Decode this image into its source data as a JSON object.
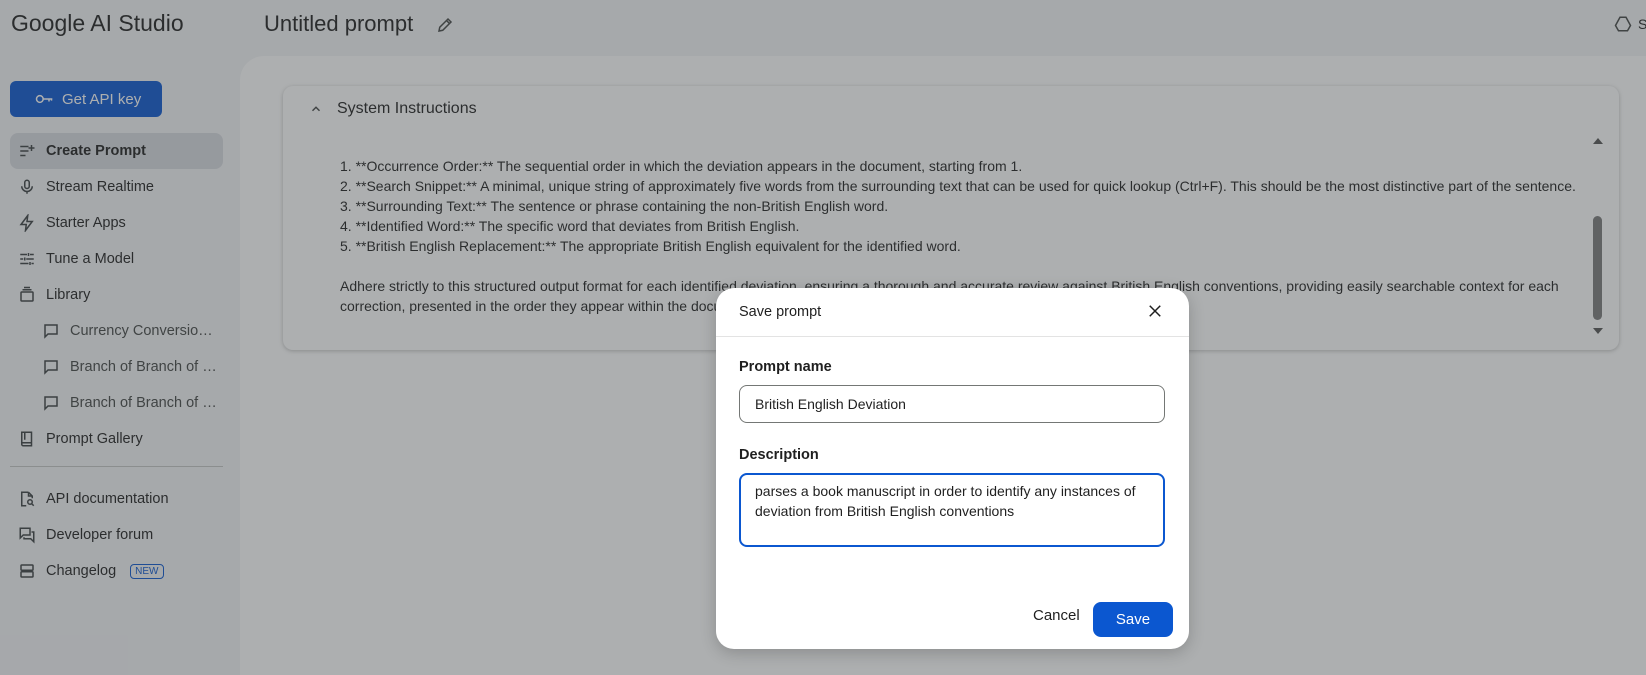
{
  "app": {
    "brand": "Google AI Studio",
    "prompt_title": "Untitled prompt",
    "top_right_partial": "S"
  },
  "sidebar": {
    "api_key_label": "Get API key",
    "items": [
      {
        "label": "Create Prompt",
        "icon": "create-prompt-icon",
        "active": true
      },
      {
        "label": "Stream Realtime",
        "icon": "mic-icon"
      },
      {
        "label": "Starter Apps",
        "icon": "bolt-icon"
      },
      {
        "label": "Tune a Model",
        "icon": "tune-icon"
      },
      {
        "label": "Library",
        "icon": "library-icon"
      }
    ],
    "library_items": [
      {
        "label": "Currency Conversion ..."
      },
      {
        "label": "Branch of Branch of B..."
      },
      {
        "label": "Branch of Branch of B..."
      }
    ],
    "gallery_label": "Prompt Gallery",
    "bottom_items": [
      {
        "label": "API documentation",
        "icon": "doc-search-icon"
      },
      {
        "label": "Developer forum",
        "icon": "forum-icon"
      },
      {
        "label": "Changelog",
        "icon": "changelog-icon",
        "badge": "NEW"
      }
    ]
  },
  "system_instructions": {
    "header": "System Instructions",
    "lines": [
      "1.  **Occurrence Order:** The sequential order in which the deviation appears in the document, starting from 1.",
      "2.  **Search Snippet:** A minimal, unique string of approximately five words from the surrounding text that can be used for quick lookup (Ctrl+F). This should be the most distinctive part of the sentence.",
      "3.  **Surrounding Text:** The sentence or phrase containing the non-British English word.",
      "4.  **Identified Word:** The specific word that deviates from British English.",
      "5.  **British English Replacement:** The appropriate British English equivalent for the identified word.",
      "",
      "Adhere strictly to this structured output format for each identified deviation, ensuring a thorough and accurate review against British English conventions, providing easily searchable context for each correction, presented in the order they appear within the document."
    ]
  },
  "dialog": {
    "title": "Save prompt",
    "name_label": "Prompt name",
    "name_value": "British English Deviation",
    "description_label": "Description",
    "description_value": "parses a book manuscript in order to identify any instances of deviation from British English conventions",
    "cancel_label": "Cancel",
    "save_label": "Save"
  }
}
